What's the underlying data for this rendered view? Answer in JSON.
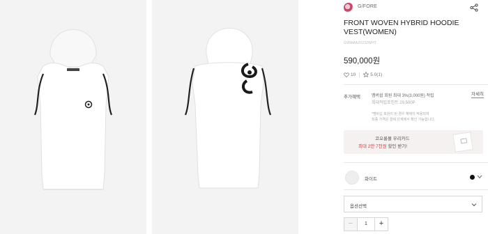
{
  "product": {
    "brand": "G/FORE",
    "title": "FRONT WOVEN HYBRID HOODIE VEST(WOMEN)",
    "sku": "GWAMA20232WHT",
    "price": "590,000원",
    "likes": "10",
    "rating": "5.0(1)"
  },
  "benefits": {
    "label": "추가혜택",
    "line1": "멤버쉽 회원 최대 3%(3,000원) 적립",
    "line2": "최대적립포인트 29,500P",
    "detail_link": "자세히",
    "note1": "*멤버십 회원이 된 경우 혜택이 적용되며",
    "note2": "최종 가격은 결제 단계에서 확인 가능합니다."
  },
  "card_banner": {
    "line1": "코오롱몰 우리카드",
    "line2_prefix": "최대 2만 7천원",
    "line2_suffix": " 할인 받기!"
  },
  "color": {
    "name": "화이트",
    "dot_color": "#111111"
  },
  "option": {
    "label": "옵션선택"
  },
  "quantity": {
    "minus": "−",
    "value": "1",
    "plus": "+"
  }
}
